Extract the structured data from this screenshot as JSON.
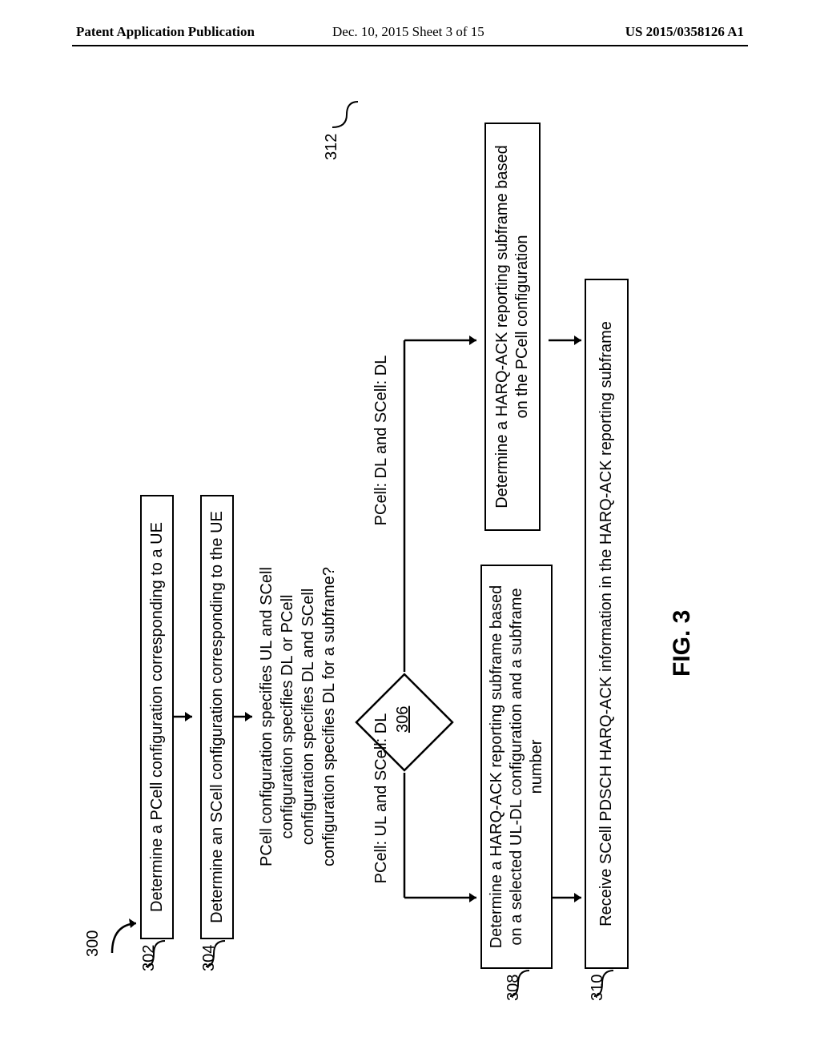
{
  "header": {
    "left": "Patent Application Publication",
    "center": "Dec. 10, 2015  Sheet 3 of 15",
    "right": "US 2015/0358126 A1"
  },
  "refs": {
    "r300": "300",
    "r302": "302",
    "r304": "304",
    "r306": "306",
    "r308": "308",
    "r310": "310",
    "r312": "312"
  },
  "blocks": {
    "b302": "Determine a PCell configuration corresponding to a UE",
    "b304": "Determine an SCell configuration corresponding to the UE",
    "b306_text": "PCell configuration specifies UL and SCell\nconfiguration specifies DL or PCell\nconfiguration specifies DL and SCell\nconfiguration specifies DL for a subframe?",
    "b306_left_label": "PCell: UL and SCell: DL",
    "b306_right_label": "PCell: DL and SCell: DL",
    "b308": "Determine a HARQ-ACK reporting subframe based\non a selected UL-DL configuration and a subframe\nnumber",
    "b312": "Determine a HARQ-ACK reporting subframe based\non the PCell configuration",
    "b310": "Receive SCell PDSCH HARQ-ACK information in the HARQ-ACK reporting subframe"
  },
  "fig_label": "FIG. 3"
}
